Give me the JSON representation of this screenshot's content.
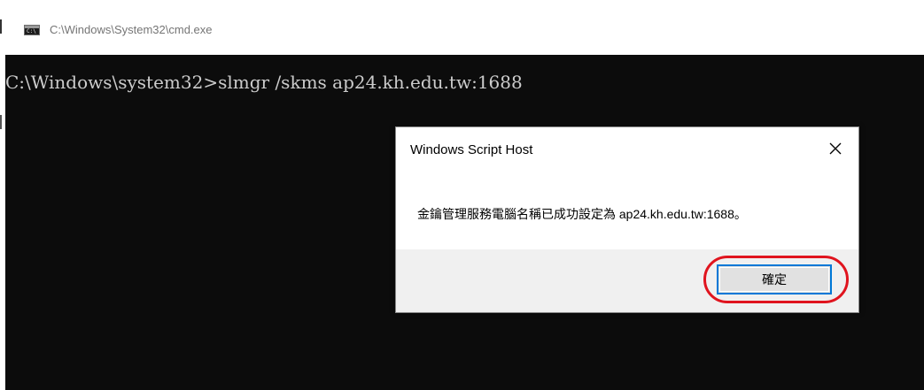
{
  "window": {
    "title": "C:\\Windows\\System32\\cmd.exe",
    "icon": "cmd-icon"
  },
  "console": {
    "line": "C:\\Windows\\system32>slmgr /skms ap24.kh.edu.tw:1688"
  },
  "dialog": {
    "title": "Windows Script Host",
    "close_icon": "close-icon",
    "message": "金鑰管理服務電腦名稱已成功設定為 ap24.kh.edu.tw:1688。",
    "ok_label": "確定"
  },
  "annotation": {
    "highlight_color": "#e0141e"
  },
  "colors": {
    "console_bg": "#0c0c0c",
    "console_text": "#cccccc",
    "button_focus": "#0078d7"
  }
}
